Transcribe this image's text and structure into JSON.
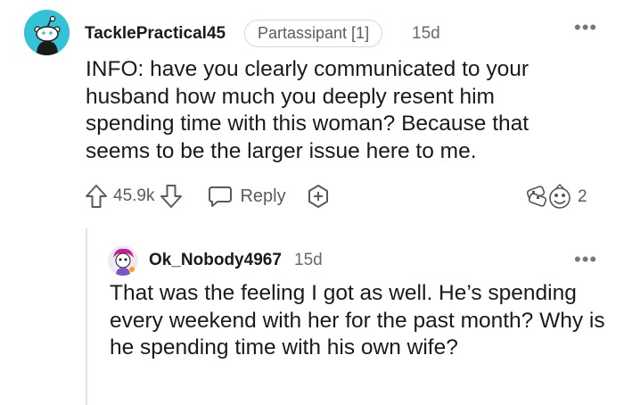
{
  "comment": {
    "username": "TacklePractical45",
    "flair": "Partassipant [1]",
    "time": "15d",
    "more": "•••",
    "body": "INFO: have you clearly communicated to your husband how much you deeply resent him spending time with this woman? Because that seems to be the larger issue here to me.",
    "votes": "45.9k",
    "reply_label": "Reply",
    "award_count": "2",
    "icons": {
      "avatar": "snoo-avatar",
      "upvote": "arrow-up-icon",
      "downvote": "arrow-down-icon",
      "reply": "speech-bubble-icon",
      "award": "plus-award-icon",
      "awards_received": "award-badges-icon"
    },
    "colors": {
      "avatar_bg": "#33c2d6"
    }
  },
  "reply": {
    "username": "Ok_Nobody4967",
    "time": "15d",
    "more": "•••",
    "body": "That was the feeling I got as well. He’s spending every weekend with her for the past month? Why is he spending time with his own wife?"
  }
}
